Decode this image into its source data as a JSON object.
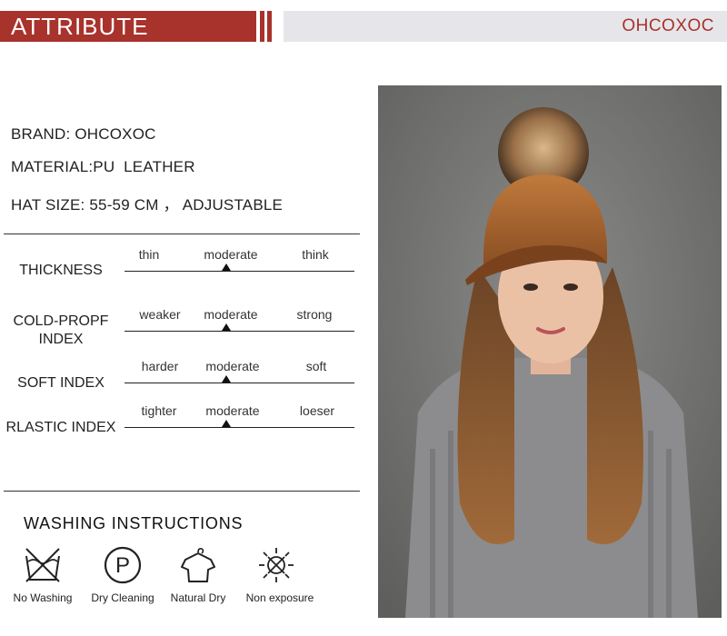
{
  "header": {
    "title": "ATTRIBUTE",
    "brand": "OHCOXOC"
  },
  "info": {
    "brand": "BRAND: OHCOXOC",
    "material": "MATERIAL:PU  LEATHER",
    "size": "HAT SIZE: 55-59 CM ， ADJUSTABLE"
  },
  "scales": [
    {
      "label": "THICKNESS",
      "options": [
        "thin",
        "moderate",
        "think"
      ],
      "selected": "moderate"
    },
    {
      "label_line1": "COLD-PROPF",
      "label_line2": "INDEX",
      "options": [
        "weaker",
        "moderate",
        "strong"
      ],
      "selected": "moderate"
    },
    {
      "label": "SOFT INDEX",
      "options": [
        "harder",
        "moderate",
        "soft"
      ],
      "selected": "moderate"
    },
    {
      "label": "RLASTIC INDEX",
      "options": [
        "tighter",
        "moderate",
        "loeser"
      ],
      "selected": "moderate"
    }
  ],
  "washing": {
    "title": "WASHING  INSTRUCTIONS",
    "items": [
      {
        "icon": "no-washing-icon",
        "label": "No  Washing"
      },
      {
        "icon": "dry-cleaning-icon",
        "label": "Dry  Cleaning"
      },
      {
        "icon": "natural-dry-icon",
        "label": "Natural  Dry"
      },
      {
        "icon": "non-exposure-icon",
        "label": "Non  exposure"
      }
    ]
  },
  "colors": {
    "accent": "#a8322c",
    "header_grey": "#e6e6ea",
    "photo_bg": "#6e6e6c",
    "cap_leather": "#a8642e"
  }
}
